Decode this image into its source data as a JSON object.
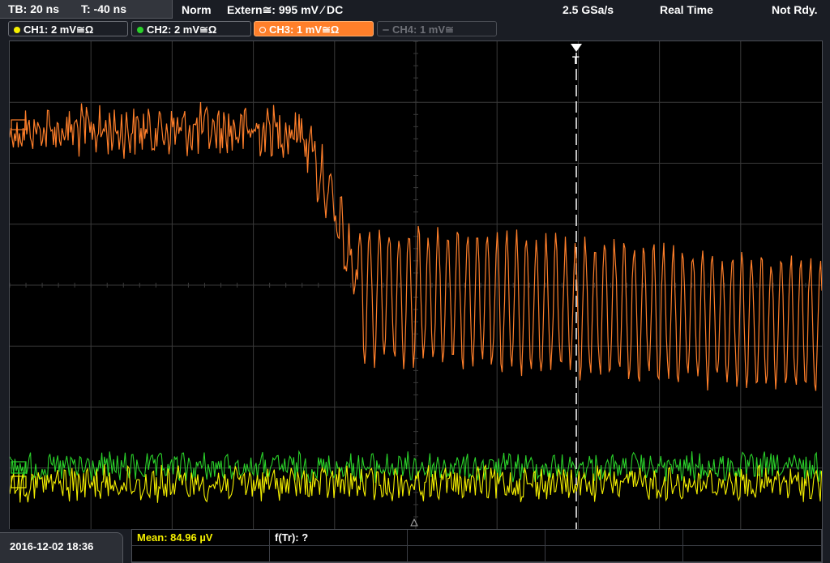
{
  "header": {
    "timebase": "TB: 20 ns",
    "trigger_time": "T: -40 ns",
    "trigger_mode": "Norm",
    "trigger_source": "Extern≅: 995 mV ⁄ DC",
    "sample_rate": "2.5 GSa/s",
    "acq_mode": "Real Time",
    "status": "Not Rdy."
  },
  "channels": [
    {
      "label": "CH1: 2 mV≅Ω",
      "color": "#f5f000",
      "state": "on"
    },
    {
      "label": "CH2: 2 mV≅Ω",
      "color": "#2ad12a",
      "state": "on"
    },
    {
      "label": "CH3: 1 mV≅Ω",
      "color": "#ff7f2a",
      "state": "selected"
    },
    {
      "label": "CH4: 1 mV≅",
      "color": "#6e7077",
      "state": "off"
    }
  ],
  "trigger_marker": "T",
  "measurements": {
    "mean": "Mean: 84.96 µV",
    "rise": "f(Tr): ?"
  },
  "footer": {
    "datetime": "2016-12-02 18:36"
  },
  "colors": {
    "ch1": "#f5f000",
    "ch2": "#2ad12a",
    "ch3": "#ff7f2a",
    "grid": "#3a3a3a",
    "background": "#000000"
  }
}
